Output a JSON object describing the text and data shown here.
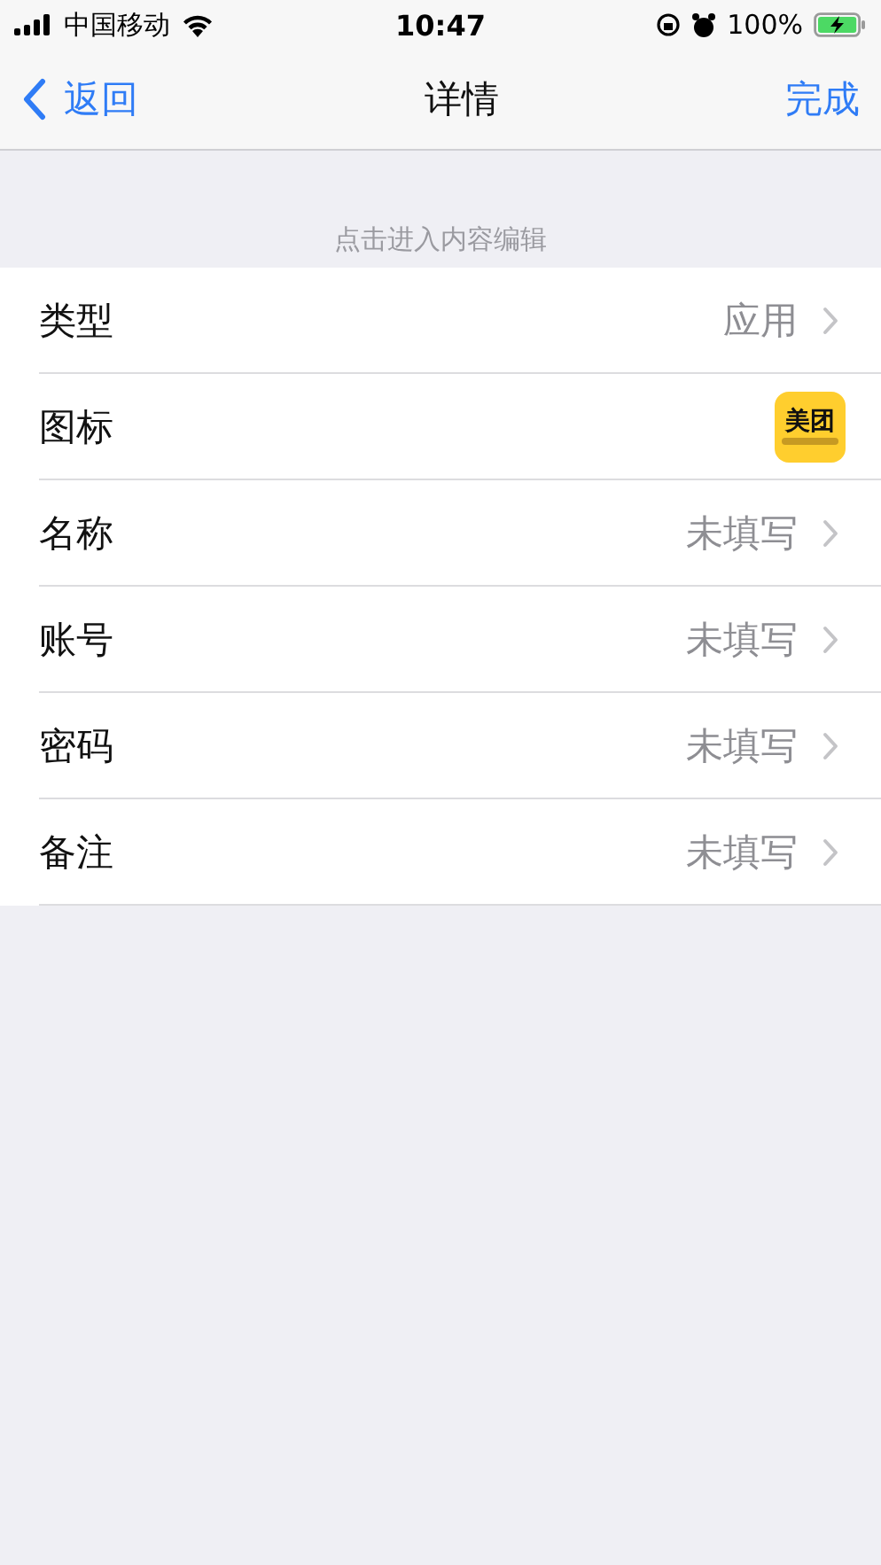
{
  "status_bar": {
    "carrier": "中国移动",
    "time": "10:47",
    "battery": "100%"
  },
  "nav": {
    "back": "返回",
    "title": "详情",
    "done": "完成"
  },
  "section_header": "点击进入内容编辑",
  "rows": [
    {
      "kind": "value",
      "label": "类型",
      "value": "应用"
    },
    {
      "kind": "icon",
      "label": "图标",
      "icon_text": "美团"
    },
    {
      "kind": "value",
      "label": "名称",
      "value": "未填写"
    },
    {
      "kind": "value",
      "label": "账号",
      "value": "未填写"
    },
    {
      "kind": "value",
      "label": "密码",
      "value": "未填写"
    },
    {
      "kind": "value",
      "label": "备注",
      "value": "未填写"
    }
  ]
}
